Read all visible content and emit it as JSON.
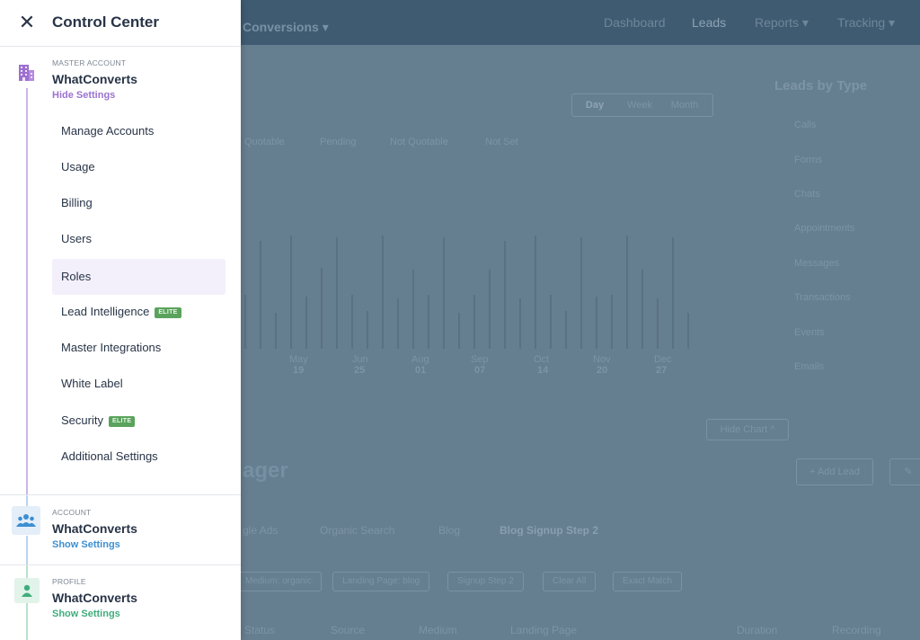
{
  "background": {
    "conversion_title": "Conversions ▾",
    "nav": [
      "Dashboard",
      "Leads",
      "Reports ▾",
      "Tracking ▾"
    ],
    "range": [
      "Day",
      "Week",
      "Month"
    ],
    "legend_quotable": [
      "Quotable",
      "Pending",
      "Not Quotable",
      "Not Set"
    ],
    "months": [
      "May",
      "Jun",
      "Aug",
      "Sep",
      "Oct",
      "Nov",
      "Dec"
    ],
    "days": [
      "19",
      "25",
      "01",
      "07",
      "14",
      "20",
      "27"
    ],
    "leads_by_type_title": "Leads by Type",
    "lead_types": [
      "Calls",
      "Forms",
      "Chats",
      "Appointments",
      "Messages",
      "Transactions",
      "Events",
      "Emails"
    ],
    "hide_chart": "Hide Chart ^",
    "manager_title": "ager",
    "add_lead": "+ Add Lead",
    "tabs": [
      "gle Ads",
      "Organic Search",
      "Blog",
      "Blog Signup Step 2"
    ],
    "filters": [
      "Medium: organic",
      "Landing Page: blog",
      "Signup Step 2",
      "Clear All",
      "Exact Match"
    ],
    "columns": [
      "Status",
      "Source",
      "Medium",
      "Landing Page",
      "Duration",
      "Recording"
    ]
  },
  "drawer": {
    "title": "Control Center",
    "master": {
      "label": "MASTER ACCOUNT",
      "name": "WhatConverts",
      "link": "Hide Settings",
      "link_color": "#9b72cf",
      "icon_bg": "#ece4f7"
    },
    "menu": [
      {
        "label": "Manage Accounts"
      },
      {
        "label": "Usage"
      },
      {
        "label": "Billing"
      },
      {
        "label": "Users"
      },
      {
        "label": "Roles",
        "active": true
      },
      {
        "label": "Lead Intelligence",
        "badge": "ELITE"
      },
      {
        "label": "Master Integrations"
      },
      {
        "label": "White Label"
      },
      {
        "label": "Security",
        "badge": "ELITE"
      },
      {
        "label": "Additional Settings"
      }
    ],
    "account": {
      "label": "ACCOUNT",
      "name": "WhatConverts",
      "link": "Show Settings",
      "link_color": "#3d8fd1",
      "icon_bg": "#e3eef9"
    },
    "profile": {
      "label": "PROFILE",
      "name": "WhatConverts",
      "link": "Show Settings",
      "link_color": "#3fae7c",
      "icon_bg": "#e2f3ea"
    }
  }
}
